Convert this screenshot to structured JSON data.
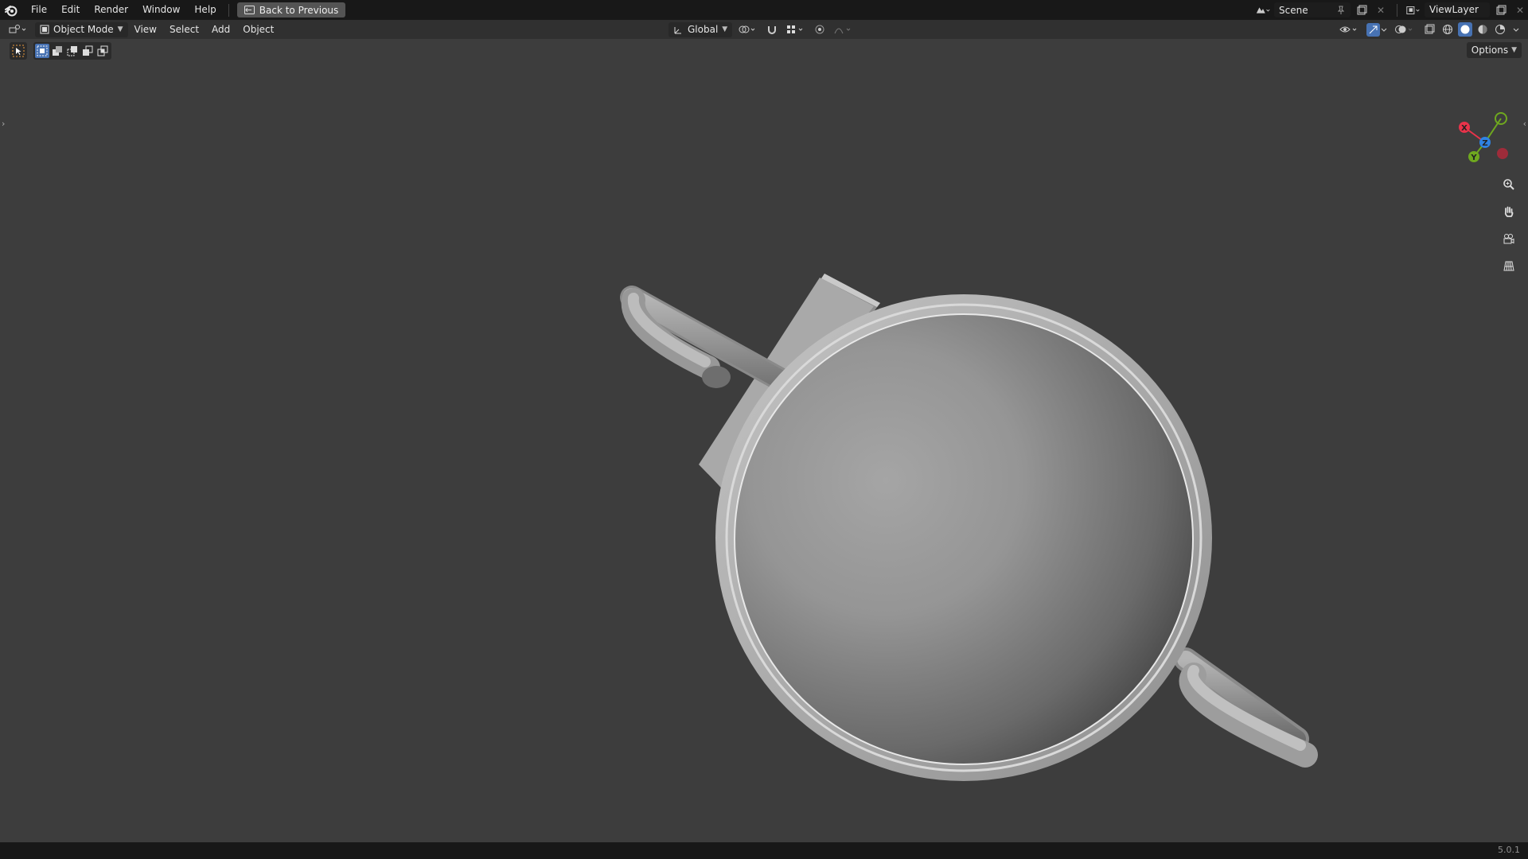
{
  "topbar": {
    "menus": [
      "File",
      "Edit",
      "Render",
      "Window",
      "Help"
    ],
    "back_button": "Back to Previous",
    "scene_name": "Scene",
    "view_layer": "ViewLayer"
  },
  "header": {
    "mode": "Object Mode",
    "menus": [
      "View",
      "Select",
      "Add",
      "Object"
    ],
    "orientation": "Global"
  },
  "toolbar": {
    "options_label": "Options"
  },
  "gizmo": {
    "x_label": "X",
    "y_label": "Y",
    "z_label": "Z",
    "x_color": "#e8334a",
    "y_color": "#6fa81f",
    "z_color": "#2f83e3"
  },
  "icons": {
    "nav": [
      "zoom-icon",
      "hand-pan-icon",
      "camera-view-icon",
      "grid-ortho-icon"
    ]
  },
  "status": {
    "version": "5.0.1"
  },
  "colors": {
    "accent": "#4772b3",
    "viewport_bg": "#3d3d3d",
    "topbar_bg": "#181818",
    "header_bg": "#303030"
  }
}
